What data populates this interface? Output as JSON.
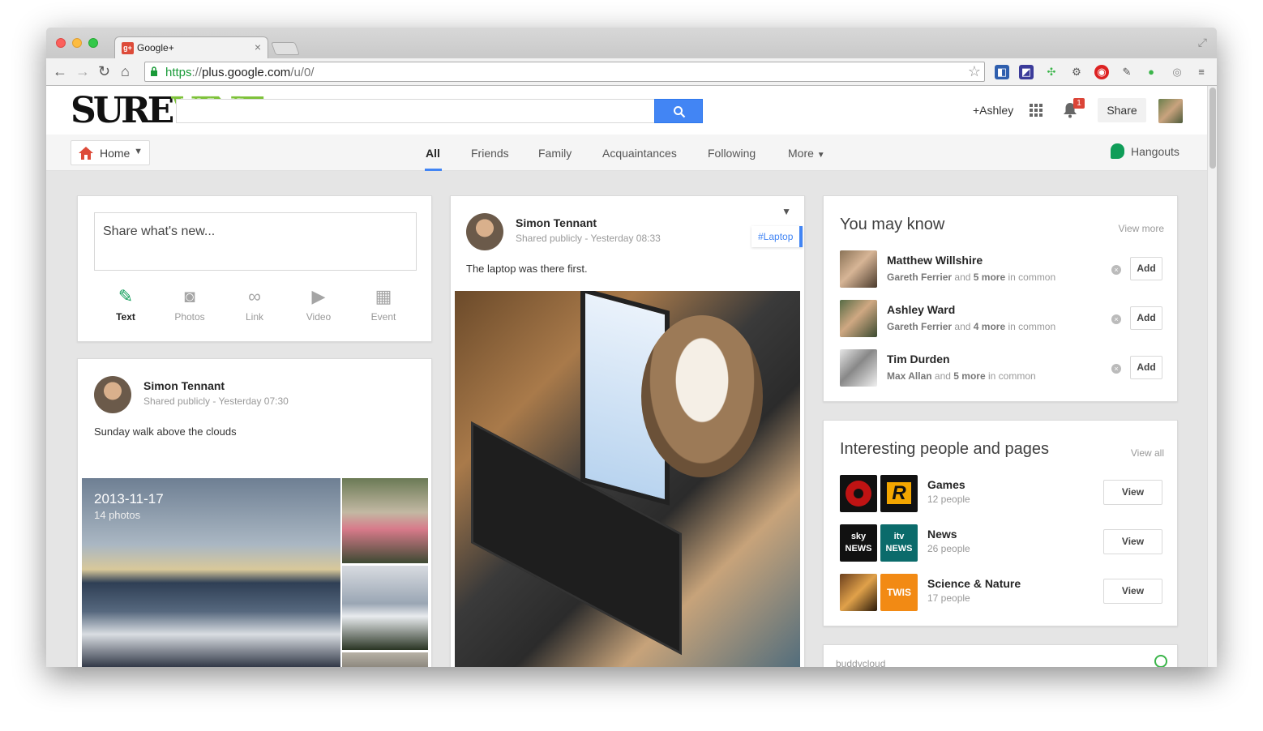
{
  "browser": {
    "tab_title": "Google+",
    "tab_favicon": "g+",
    "url_scheme": "https",
    "url_sep": "://",
    "url_host": "plus.google.com",
    "url_path": "/u/0/"
  },
  "header": {
    "logo_part1": "SURE",
    "logo_part2": "VINE",
    "search_placeholder": "",
    "profile_link": "+Ashley",
    "notification_count": "1",
    "share_label": "Share"
  },
  "nav": {
    "home_label": "Home",
    "tabs": [
      "All",
      "Friends",
      "Family",
      "Acquaintances",
      "Following",
      "More"
    ],
    "hangouts_label": "Hangouts"
  },
  "share_box": {
    "prompt": "Share what's new...",
    "actions": [
      "Text",
      "Photos",
      "Link",
      "Video",
      "Event"
    ]
  },
  "posts": [
    {
      "author": "Simon Tennant",
      "visibility": "Shared publicly",
      "time": "Yesterday 07:30",
      "text": "Sunday walk above the clouds",
      "album_date": "2013-11-17",
      "album_count": "14 photos"
    },
    {
      "author": "Simon Tennant",
      "visibility": "Shared publicly",
      "time": "Yesterday 08:33",
      "text": "The laptop was there first.",
      "hashtag": "#Laptop"
    }
  ],
  "you_may_know": {
    "title": "You may know",
    "link": "View more",
    "add_label": "Add",
    "people": [
      {
        "name": "Matthew Willshire",
        "via": "Gareth Ferrier",
        "and": "and",
        "more": "5 more",
        "suffix": "in common"
      },
      {
        "name": "Ashley Ward",
        "via": "Gareth Ferrier",
        "and": "and",
        "more": "4 more",
        "suffix": "in common"
      },
      {
        "name": "Tim Durden",
        "via": "Max Allan",
        "and": "and",
        "more": "5 more",
        "suffix": "in common"
      }
    ]
  },
  "interesting": {
    "title": "Interesting people and pages",
    "link": "View all",
    "view_label": "View",
    "categories": [
      {
        "name": "Games",
        "count": "12 people"
      },
      {
        "name": "News",
        "count": "26 people"
      },
      {
        "name": "Science & Nature",
        "count": "17 people"
      }
    ],
    "logo_texts": [
      "R",
      "sky NEWS",
      "itv NEWS",
      "TWIS"
    ]
  },
  "buddycloud": {
    "title": "buddycloud"
  },
  "colors": {
    "accent": "#4285f4",
    "green": "#0f9d58",
    "badge": "#db4437"
  }
}
